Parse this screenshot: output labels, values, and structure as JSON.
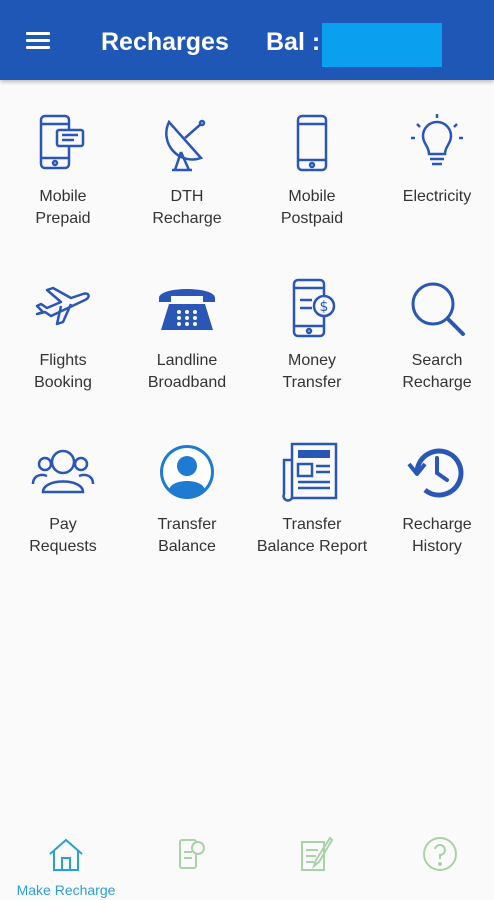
{
  "header": {
    "title": "Recharges",
    "balance_label": "Bal :",
    "menu_icon": "menu-icon",
    "accent_color": "#1f57b6",
    "balance_bg": "#0aa0ef"
  },
  "services": [
    {
      "line1": "Mobile",
      "line2": "Prepaid",
      "icon": "mobile-prepaid-icon"
    },
    {
      "line1": "DTH",
      "line2": "Recharge",
      "icon": "satellite-dish-icon"
    },
    {
      "line1": "Mobile",
      "line2": "Postpaid",
      "icon": "smartphone-icon"
    },
    {
      "line1": "Electricity",
      "line2": "",
      "icon": "light-bulb-icon"
    },
    {
      "line1": "Flights",
      "line2": "Booking",
      "icon": "airplane-icon"
    },
    {
      "line1": "Landline",
      "line2": "Broadband",
      "icon": "telephone-icon"
    },
    {
      "line1": "Money",
      "line2": "Transfer",
      "icon": "money-transfer-icon"
    },
    {
      "line1": "Search",
      "line2": "Recharge",
      "icon": "search-icon"
    },
    {
      "line1": "Pay",
      "line2": "Requests",
      "icon": "users-icon"
    },
    {
      "line1": "Transfer",
      "line2": "Balance",
      "icon": "user-avatar-icon"
    },
    {
      "line1": "Transfer",
      "line2": "Balance Report",
      "icon": "newspaper-icon"
    },
    {
      "line1": "Recharge",
      "line2": "History",
      "icon": "history-icon"
    }
  ],
  "bottom_nav": [
    {
      "label": "Make Recharge",
      "icon": "home-icon",
      "active": true
    },
    {
      "label": "",
      "icon": "mobile-rupee-icon",
      "active": false
    },
    {
      "label": "",
      "icon": "edit-note-icon",
      "active": false
    },
    {
      "label": "",
      "icon": "help-icon",
      "active": false
    }
  ]
}
